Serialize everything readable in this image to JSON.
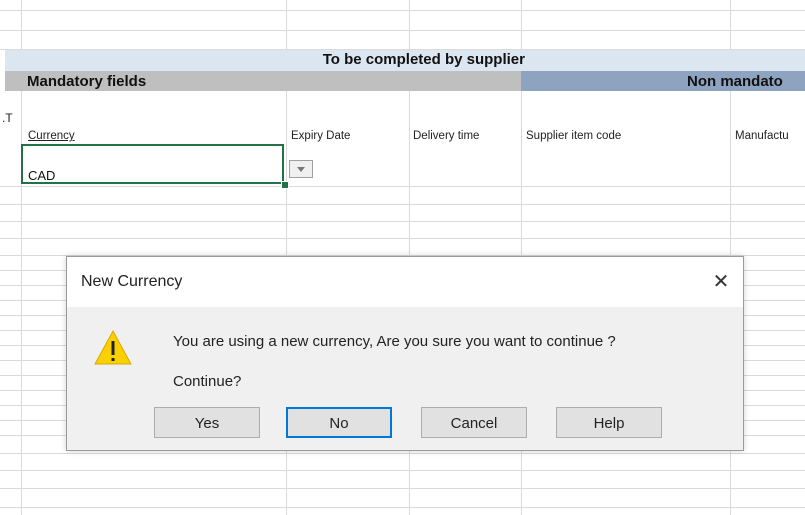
{
  "sheet": {
    "header_supplier": "To be completed by supplier",
    "mandatory_label": "Mandatory fields",
    "non_mandatory_label": "Non mandato",
    "truncated_cell_text": ".T",
    "columns": [
      {
        "label": "Currency"
      },
      {
        "label": "Expiry Date"
      },
      {
        "label": "Delivery time"
      },
      {
        "label": "Supplier item code"
      },
      {
        "label": "Manufactu"
      }
    ],
    "active_cell_value": "CAD",
    "accent_color": "#217346"
  },
  "dialog": {
    "title": "New Currency",
    "close_glyph": "✕",
    "icon": "warning-icon",
    "message": "You are using a new currency, Are you sure you want to continue ?",
    "question": "Continue?",
    "buttons": {
      "yes": "Yes",
      "no": "No",
      "cancel": "Cancel",
      "help": "Help"
    },
    "default_button_color": "#0078d7"
  }
}
